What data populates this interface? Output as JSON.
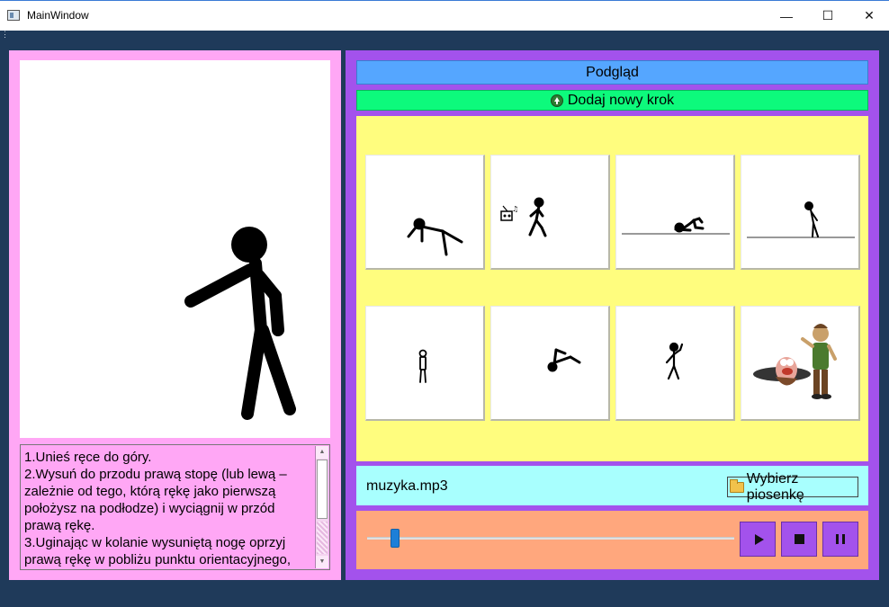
{
  "window": {
    "title": "MainWindow",
    "minimize_glyph": "—",
    "maximize_glyph": "☐",
    "close_glyph": "✕"
  },
  "instructions": {
    "lines": [
      "1.Unieś ręce do góry.",
      "2.Wysuń do przodu prawą stopę (lub lewą – zależnie od tego, którą rękę jako pierwszą położysz na podłodze) i wyciągnij w przód prawą rękę.",
      "3.Uginając w kolanie wysuniętą nogę oprzyj prawą rękę w pobliżu punktu orientacyjnego,"
    ]
  },
  "buttons": {
    "preview_label": "Podgląd",
    "add_step_label": "Dodaj nowy krok",
    "choose_song_label": "Wybierz piosenkę"
  },
  "music": {
    "filename": "muzyka.mp3",
    "progress_fraction": 0.07
  },
  "steps": [
    {
      "name": "step-tile-1",
      "icon": "stickman-lying-down-icon"
    },
    {
      "name": "step-tile-2",
      "icon": "stickman-walking-radio-icon"
    },
    {
      "name": "step-tile-3",
      "icon": "stickman-crawling-on-floor-icon"
    },
    {
      "name": "step-tile-4",
      "icon": "stickman-bending-over-icon"
    },
    {
      "name": "step-tile-5",
      "icon": "stickman-standing-icon"
    },
    {
      "name": "step-tile-6",
      "icon": "stickman-breakdance-icon"
    },
    {
      "name": "step-tile-7",
      "icon": "stickman-waving-icon"
    },
    {
      "name": "step-tile-8",
      "icon": "cartoon-dancing-characters-icon"
    }
  ],
  "icons": {
    "play": "play-icon",
    "stop": "stop-icon",
    "pause": "pause-icon",
    "folder": "folder-icon",
    "add": "add-circle-icon"
  },
  "colors": {
    "left_panel": "#ffa7f5",
    "right_panel": "#a352ec",
    "preview_button": "#55a6ff",
    "add_button": "#0dfa7c",
    "steps_area": "#fffd7e",
    "music_bar": "#a8fffe",
    "player_bar": "#ffa77d",
    "slider_handle": "#1e7fd8"
  }
}
